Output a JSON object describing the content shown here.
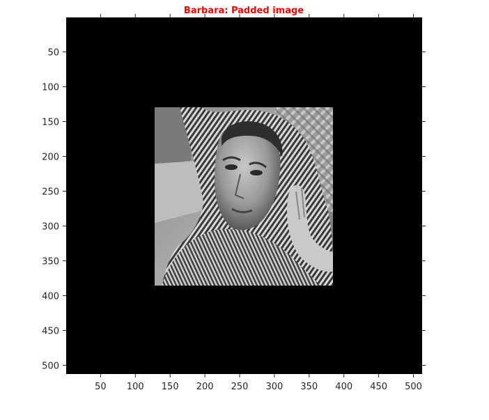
{
  "figure": {
    "title": "Barbara: Padded image",
    "title_color": "#ff0000",
    "background_color": "#ffffff",
    "axes_color": "#000000",
    "tick_color": "#262626"
  },
  "chart_data": {
    "type": "heatmap",
    "title": "Barbara: Padded image",
    "xlabel": "",
    "ylabel": "",
    "colormap": "gray",
    "padding_color": "#000000",
    "image_size": [
      512,
      512
    ],
    "xlim": [
      0.5,
      512.5
    ],
    "ylim": [
      0.5,
      512.5
    ],
    "y_axis_direction": "reverse",
    "inner_image": {
      "name": "Barbara",
      "x_range": [
        129,
        384
      ],
      "y_range": [
        129,
        384
      ]
    },
    "xticks": [
      50,
      100,
      150,
      200,
      250,
      300,
      350,
      400,
      450,
      500
    ],
    "yticks": [
      50,
      100,
      150,
      200,
      250,
      300,
      350,
      400,
      450,
      500
    ],
    "grid": false
  }
}
